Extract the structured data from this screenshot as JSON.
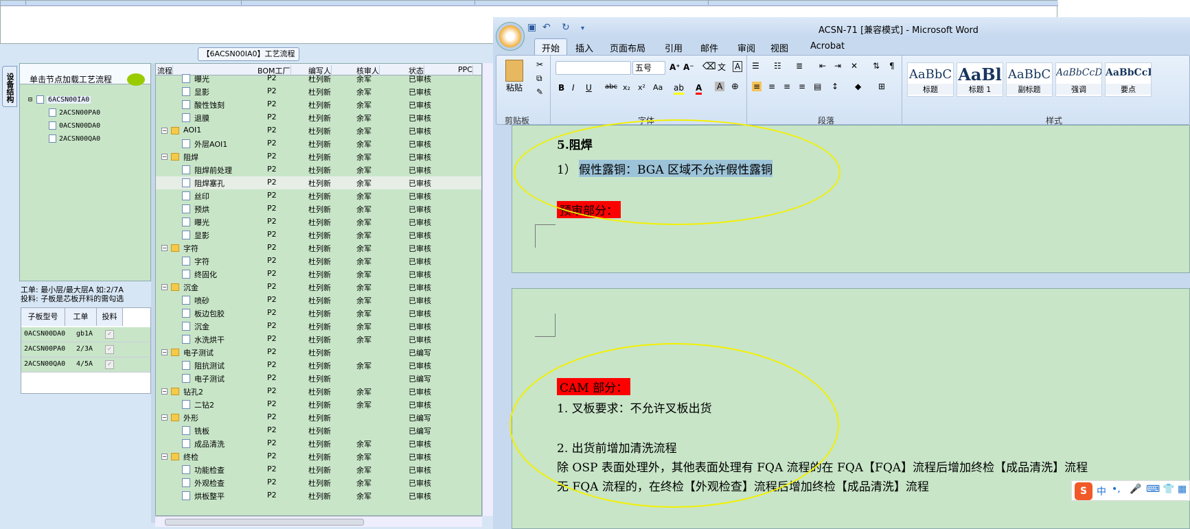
{
  "left_app": {
    "title_tag": "【6ACSN00IA0】工艺流程",
    "side_tab": "设备结构",
    "panel_header": "单击节点加载工艺流程",
    "tree": [
      {
        "label": "6ACSN00IA0",
        "level": 0
      },
      {
        "label": "2ACSN00PA0",
        "level": 1
      },
      {
        "label": "0ACSN00DA0",
        "level": 1
      },
      {
        "label": "2ACSN00QA0",
        "level": 1
      }
    ],
    "info_line1": "工单: 最小层/最大层A 如:2/7A",
    "info_line2": "投料: 子板是芯板开料的需勾选",
    "sub_headers": [
      "子板型号",
      "工单",
      "投料"
    ],
    "sub_rows": [
      {
        "model": "0ACSN00DA0",
        "order": "gb1A",
        "check": "✓"
      },
      {
        "model": "2ACSN00PA0",
        "order": "2/3A",
        "check": "✓"
      },
      {
        "model": "2ACSN00QA0",
        "order": "4/5A",
        "check": "✓"
      }
    ]
  },
  "flow_grid": {
    "headers": [
      "流程",
      "BOM工厂",
      "编写人",
      "核审人",
      "状态",
      "PPC"
    ],
    "rows": [
      {
        "name": "曝光",
        "type": "doc",
        "level": 2,
        "bom": "P2",
        "writer": "杜列新",
        "reviewer": "余军",
        "status": "已审核"
      },
      {
        "name": "显影",
        "type": "doc",
        "level": 2,
        "bom": "P2",
        "writer": "杜列新",
        "reviewer": "余军",
        "status": "已审核"
      },
      {
        "name": "酸性蚀刻",
        "type": "doc",
        "level": 2,
        "bom": "P2",
        "writer": "杜列新",
        "reviewer": "余军",
        "status": "已审核"
      },
      {
        "name": "退膜",
        "type": "doc",
        "level": 2,
        "bom": "P2",
        "writer": "杜列新",
        "reviewer": "余军",
        "status": "已审核"
      },
      {
        "name": "AOI1",
        "type": "folder",
        "level": 1,
        "bom": "P2",
        "writer": "杜列新",
        "reviewer": "余军",
        "status": "已审核"
      },
      {
        "name": "外层AOI1",
        "type": "doc",
        "level": 2,
        "bom": "P2",
        "writer": "杜列新",
        "reviewer": "余军",
        "status": "已审核"
      },
      {
        "name": "阻焊",
        "type": "folder",
        "level": 1,
        "bom": "P2",
        "writer": "杜列新",
        "reviewer": "余军",
        "status": "已审核"
      },
      {
        "name": "阻焊前处理",
        "type": "doc",
        "level": 2,
        "bom": "P2",
        "writer": "杜列新",
        "reviewer": "余军",
        "status": "已审核"
      },
      {
        "name": "阻焊塞孔",
        "type": "doc",
        "level": 2,
        "bom": "P2",
        "writer": "杜列新",
        "reviewer": "余军",
        "status": "已审核",
        "hl": true
      },
      {
        "name": "丝印",
        "type": "doc",
        "level": 2,
        "bom": "P2",
        "writer": "杜列新",
        "reviewer": "余军",
        "status": "已审核"
      },
      {
        "name": "预烘",
        "type": "doc",
        "level": 2,
        "bom": "P2",
        "writer": "杜列新",
        "reviewer": "余军",
        "status": "已审核"
      },
      {
        "name": "曝光",
        "type": "doc",
        "level": 2,
        "bom": "P2",
        "writer": "杜列新",
        "reviewer": "余军",
        "status": "已审核"
      },
      {
        "name": "显影",
        "type": "doc",
        "level": 2,
        "bom": "P2",
        "writer": "杜列新",
        "reviewer": "余军",
        "status": "已审核"
      },
      {
        "name": "字符",
        "type": "folder",
        "level": 1,
        "bom": "P2",
        "writer": "杜列新",
        "reviewer": "余军",
        "status": "已审核"
      },
      {
        "name": "字符",
        "type": "doc",
        "level": 2,
        "bom": "P2",
        "writer": "杜列新",
        "reviewer": "余军",
        "status": "已审核"
      },
      {
        "name": "终固化",
        "type": "doc",
        "level": 2,
        "bom": "P2",
        "writer": "杜列新",
        "reviewer": "余军",
        "status": "已审核"
      },
      {
        "name": "沉金",
        "type": "folder",
        "level": 1,
        "bom": "P2",
        "writer": "杜列新",
        "reviewer": "余军",
        "status": "已审核"
      },
      {
        "name": "喷砂",
        "type": "doc",
        "level": 2,
        "bom": "P2",
        "writer": "杜列新",
        "reviewer": "余军",
        "status": "已审核"
      },
      {
        "name": "板边包胶",
        "type": "doc",
        "level": 2,
        "bom": "P2",
        "writer": "杜列新",
        "reviewer": "余军",
        "status": "已审核"
      },
      {
        "name": "沉金",
        "type": "doc",
        "level": 2,
        "bom": "P2",
        "writer": "杜列新",
        "reviewer": "余军",
        "status": "已审核"
      },
      {
        "name": "水洗烘干",
        "type": "doc",
        "level": 2,
        "bom": "P2",
        "writer": "杜列新",
        "reviewer": "余军",
        "status": "已审核"
      },
      {
        "name": "电子测试",
        "type": "folder",
        "level": 1,
        "bom": "P2",
        "writer": "杜列新",
        "reviewer": "",
        "status": "已编写"
      },
      {
        "name": "阻抗测试",
        "type": "doc",
        "level": 2,
        "bom": "P2",
        "writer": "杜列新",
        "reviewer": "余军",
        "status": "已审核"
      },
      {
        "name": "电子测试",
        "type": "doc",
        "level": 2,
        "bom": "P2",
        "writer": "杜列新",
        "reviewer": "",
        "status": "已编写"
      },
      {
        "name": "钻孔2",
        "type": "folder",
        "level": 1,
        "bom": "P2",
        "writer": "杜列新",
        "reviewer": "余军",
        "status": "已审核"
      },
      {
        "name": "二钻2",
        "type": "doc",
        "level": 2,
        "bom": "P2",
        "writer": "杜列新",
        "reviewer": "余军",
        "status": "已审核"
      },
      {
        "name": "外形",
        "type": "folder",
        "level": 1,
        "bom": "P2",
        "writer": "杜列新",
        "reviewer": "",
        "status": "已编写"
      },
      {
        "name": "铣板",
        "type": "doc",
        "level": 2,
        "bom": "P2",
        "writer": "杜列新",
        "reviewer": "",
        "status": "已编写"
      },
      {
        "name": "成品清洗",
        "type": "doc",
        "level": 2,
        "bom": "P2",
        "writer": "杜列新",
        "reviewer": "余军",
        "status": "已审核"
      },
      {
        "name": "终检",
        "type": "folder",
        "level": 1,
        "bom": "P2",
        "writer": "杜列新",
        "reviewer": "余军",
        "status": "已审核"
      },
      {
        "name": "功能检查",
        "type": "doc",
        "level": 2,
        "bom": "P2",
        "writer": "杜列新",
        "reviewer": "余军",
        "status": "已审核"
      },
      {
        "name": "外观检查",
        "type": "doc",
        "level": 2,
        "bom": "P2",
        "writer": "杜列新",
        "reviewer": "余军",
        "status": "已审核"
      },
      {
        "name": "烘板整平",
        "type": "doc",
        "level": 2,
        "bom": "P2",
        "writer": "杜列新",
        "reviewer": "余军",
        "status": "已审核"
      }
    ]
  },
  "word": {
    "title": "ACSN-71 [兼容模式] - Microsoft Word",
    "tabs": [
      "开始",
      "插入",
      "页面布局",
      "引用",
      "邮件",
      "审阅",
      "视图",
      "Acrobat"
    ],
    "active_tab": "开始",
    "groups": [
      "剪贴板",
      "字体",
      "段落",
      "样式"
    ],
    "paste_label": "粘贴",
    "font_size": "五号",
    "styles": [
      {
        "preview": "AaBbC",
        "name": "标题"
      },
      {
        "preview": "AaBl",
        "name": "标题 1"
      },
      {
        "preview": "AaBbC",
        "name": "副标题"
      },
      {
        "preview": "AaBbCcD",
        "name": "强调"
      },
      {
        "preview": "AaBbCcD",
        "name": "要点"
      }
    ],
    "page1": {
      "heading": "5.阻焊",
      "line1_prefix": "1）",
      "line1_hl": "假性露铜：BGA 区域不允许假性露铜",
      "red_label": "预审部分："
    },
    "page2": {
      "red_label": "CAM 部分：",
      "line1": "1. 叉板要求：不允许叉板出货",
      "line2": "2. 出货前增加清洗流程",
      "line3": "除 OSP 表面处理外，其他表面处理有 FQA 流程的在 FQA【FQA】流程后增加终检【成品清洗】流程",
      "line4": "无 FQA 流程的，在终检【外观检查】流程后增加终检【成品清洗】流程"
    }
  },
  "ime": {
    "logo": "S",
    "mode": "中"
  },
  "colors": {
    "green_bg": "#c8e5c8",
    "red": "#ff0000",
    "ellipse": "#f2f000"
  }
}
